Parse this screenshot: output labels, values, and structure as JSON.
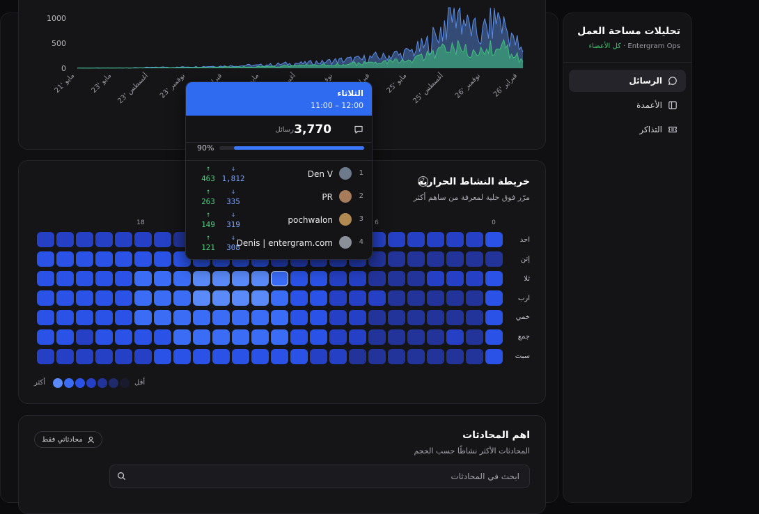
{
  "sidebar": {
    "title": "تحليلات مساحة العمل",
    "workspace": "Entergram Ops",
    "separator": "·",
    "members": "كل الأعضاء",
    "items": [
      {
        "label": "الرسائل",
        "icon": "message-icon",
        "active": true
      },
      {
        "label": "الأعمدة",
        "icon": "columns-icon",
        "active": false
      },
      {
        "label": "التذاكر",
        "icon": "ticket-icon",
        "active": false
      }
    ]
  },
  "chart_data": {
    "type": "area",
    "title": "",
    "ylim": [
      0,
      1150
    ],
    "yticks": [
      "1000",
      "500",
      "0"
    ],
    "xtick_labels": [
      "21' مايو",
      "23' مايو",
      "23' أغسطس",
      "23' نوفمبر",
      "24' فبراير",
      "24' مايو",
      "24' أغسطس",
      "25' نوفمبر",
      "25' فبراير",
      "25' مايو",
      "25' أغسطس",
      "26' نوفمبر",
      "26' فبراير"
    ],
    "colors": {
      "series_a": "#5b8ee8",
      "series_b": "#3fbf7a"
    },
    "series": [
      {
        "values": [
          5,
          5,
          5,
          6,
          5,
          6,
          6,
          7,
          8,
          8,
          10,
          12,
          15,
          18,
          20,
          22,
          18,
          20,
          25,
          30,
          28,
          32,
          35,
          40,
          38,
          42,
          45,
          50,
          48,
          55,
          60,
          55,
          62,
          70,
          65,
          80,
          90,
          85,
          100,
          95,
          110,
          120,
          115,
          130,
          140,
          150,
          160,
          170,
          180,
          175,
          190,
          210,
          230,
          220,
          250,
          280,
          260,
          300,
          340,
          380,
          420,
          500,
          600,
          750,
          900,
          1100,
          1150,
          950,
          800,
          700,
          650,
          780,
          900,
          1000,
          850,
          700,
          500,
          350
        ]
      },
      {
        "values": [
          3,
          3,
          3,
          3,
          3,
          4,
          4,
          4,
          5,
          5,
          6,
          7,
          8,
          10,
          11,
          12,
          10,
          12,
          14,
          16,
          15,
          17,
          18,
          20,
          19,
          22,
          24,
          26,
          25,
          28,
          30,
          28,
          32,
          36,
          34,
          40,
          45,
          42,
          50,
          48,
          55,
          60,
          58,
          65,
          70,
          75,
          80,
          85,
          90,
          88,
          95,
          105,
          115,
          110,
          125,
          140,
          130,
          150,
          170,
          190,
          210,
          250,
          300,
          360,
          420,
          480,
          460,
          400,
          350,
          320,
          300,
          360,
          420,
          450,
          400,
          330,
          250,
          180
        ]
      }
    ]
  },
  "heatmap": {
    "title": "خريطة النشاط الحرارية",
    "subtitle": "مرّر فوق خلية لمعرفة من ساهم أكثر",
    "hour_labels": [
      "0",
      "6",
      "18"
    ],
    "days": [
      "احد",
      "إثن",
      "ثلا",
      "ارب",
      "خمي",
      "جمع",
      "سبت"
    ],
    "less_label": "أقل",
    "more_label": "أكثر",
    "colors": [
      "#1a1a2e",
      "#1f2a6b",
      "#22339a",
      "#2540c4",
      "#2a52e6",
      "#3a6cf5",
      "#5a8af9"
    ],
    "intensity": [
      [
        4,
        3,
        3,
        3,
        3,
        3,
        3,
        2,
        2,
        2,
        2,
        2,
        2,
        2,
        2,
        2,
        2,
        3,
        3,
        3,
        3,
        3,
        3,
        3
      ],
      [
        2,
        2,
        2,
        2,
        2,
        2,
        2,
        3,
        3,
        3,
        3,
        3,
        4,
        4,
        4,
        4,
        4,
        4,
        4,
        4,
        4,
        4,
        4,
        4
      ],
      [
        4,
        3,
        3,
        3,
        2,
        2,
        2,
        3,
        3,
        4,
        4,
        5,
        6,
        6,
        6,
        6,
        5,
        5,
        5,
        4,
        4,
        4,
        4,
        4
      ],
      [
        4,
        2,
        2,
        2,
        2,
        2,
        3,
        3,
        3,
        4,
        4,
        5,
        6,
        6,
        6,
        6,
        5,
        5,
        5,
        4,
        4,
        4,
        4,
        4
      ],
      [
        4,
        2,
        2,
        2,
        2,
        2,
        2,
        3,
        3,
        4,
        4,
        5,
        5,
        5,
        5,
        5,
        5,
        5,
        5,
        4,
        4,
        4,
        4,
        4
      ],
      [
        4,
        2,
        3,
        2,
        2,
        2,
        2,
        3,
        3,
        4,
        4,
        5,
        5,
        5,
        5,
        5,
        5,
        4,
        4,
        4,
        4,
        3,
        4,
        4
      ],
      [
        4,
        2,
        2,
        2,
        2,
        2,
        2,
        2,
        3,
        3,
        4,
        4,
        4,
        4,
        4,
        4,
        4,
        4,
        3,
        3,
        3,
        3,
        3,
        3
      ]
    ]
  },
  "tooltip": {
    "day": "الثلاثاء",
    "time": "11:00 – 12:00",
    "total": "3,770",
    "unit": "رسائل",
    "percent_label": "90%",
    "percent": 0.9,
    "contributors": [
      {
        "rank": "1",
        "name": "Den V",
        "in": "1,812",
        "out": "463",
        "avatar": "#6d7a8c"
      },
      {
        "rank": "2",
        "name": "PR",
        "in": "335",
        "out": "263",
        "avatar": "#a67c5b"
      },
      {
        "rank": "3",
        "name": "pochwalon",
        "in": "319",
        "out": "149",
        "avatar": "#b08a50"
      },
      {
        "rank": "4",
        "name": "Denis | entergram.com",
        "in": "308",
        "out": "121",
        "avatar": "#8a8f98"
      }
    ]
  },
  "conversations": {
    "title": "اهم المحادثات",
    "subtitle": "المحادثات الأكثر نشاطًا حسب الحجم",
    "mine_only": "محادثاتي فقط",
    "search_placeholder": "ابحث في المحادثات"
  }
}
